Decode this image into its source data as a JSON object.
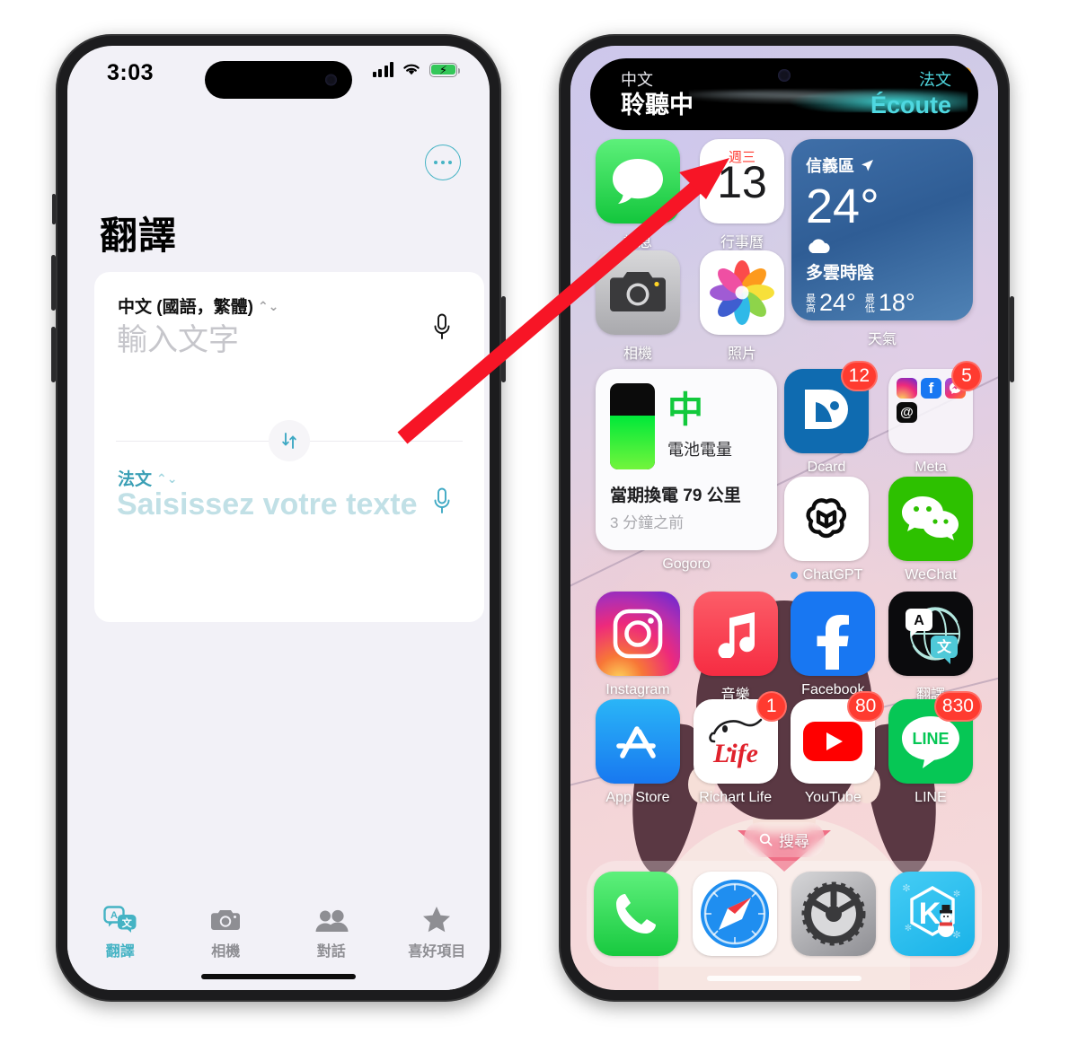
{
  "left_phone": {
    "status_bar": {
      "time": "3:03",
      "signal_icon": "cellular-bars-icon",
      "wifi_icon": "wifi-icon",
      "battery_icon": "battery-charging-icon"
    },
    "more_button": "more-options-icon",
    "app_title": "翻譯",
    "translate_card": {
      "source_language": "中文 (國語，繁體)",
      "source_placeholder": "輸入文字",
      "target_language": "法文",
      "target_placeholder": "Saisissez votre texte",
      "swap_icon": "swap-vertical-icon",
      "mic_icon": "microphone-icon"
    },
    "tabs": [
      {
        "label": "翻譯",
        "icon": "translate-icon",
        "active": true
      },
      {
        "label": "相機",
        "icon": "camera-icon",
        "active": false
      },
      {
        "label": "對話",
        "icon": "people-icon",
        "active": false
      },
      {
        "label": "喜好項目",
        "icon": "star-icon",
        "active": false
      }
    ],
    "accent_color": "#45b3c4"
  },
  "right_phone": {
    "mic_indicator": "orange-microphone-dot",
    "dynamic_island": {
      "left_small": "中文",
      "left_big": "聆聽中",
      "right_small": "法文",
      "right_big": "Écoute",
      "waveform_color": "#40e2e2"
    },
    "row1": [
      {
        "name": "訊息",
        "icon": "messages-icon"
      },
      {
        "name": "行事曆",
        "icon": "calendar-icon",
        "weekday": "週三",
        "day": "13"
      }
    ],
    "weather_widget": {
      "location": "信義區",
      "location_icon": "location-arrow-icon",
      "temperature": "24°",
      "condition_icon": "cloud-icon",
      "condition": "多雲時陰",
      "high_label": "最高",
      "high": "24°",
      "low_label": "最低",
      "low": "18°",
      "label": "天氣"
    },
    "row2": [
      {
        "name": "相機",
        "icon": "camera-app-icon"
      },
      {
        "name": "照片",
        "icon": "photos-icon"
      }
    ],
    "gogoro_widget": {
      "battery_icon": "battery-level-icon",
      "level": "中",
      "level_caption": "電池電量",
      "range_text": "當期換電 79 公里",
      "updated": "3 分鐘之前",
      "label": "Gogoro"
    },
    "row3": [
      {
        "name": "Dcard",
        "icon": "dcard-icon",
        "badge": "12"
      },
      {
        "name": "Meta",
        "icon": "meta-folder-icon",
        "badge": "5"
      }
    ],
    "row4": [
      {
        "name": "ChatGPT",
        "icon": "chatgpt-icon",
        "new_dot": true
      },
      {
        "name": "WeChat",
        "icon": "wechat-icon"
      }
    ],
    "row5": [
      {
        "name": "Instagram",
        "icon": "instagram-icon"
      },
      {
        "name": "音樂",
        "icon": "apple-music-icon"
      },
      {
        "name": "Facebook",
        "icon": "facebook-icon"
      },
      {
        "name": "翻譯",
        "icon": "translate-app-icon"
      }
    ],
    "row6": [
      {
        "name": "App Store",
        "icon": "app-store-icon"
      },
      {
        "name": "Richart Life",
        "icon": "richart-life-icon",
        "badge": "1"
      },
      {
        "name": "YouTube",
        "icon": "youtube-icon",
        "badge": "80"
      },
      {
        "name": "LINE",
        "icon": "line-icon",
        "badge": "830"
      }
    ],
    "search_pill": {
      "label": "搜尋",
      "icon": "search-icon"
    },
    "dock": [
      {
        "name": "Phone",
        "icon": "phone-icon"
      },
      {
        "name": "Safari",
        "icon": "safari-icon"
      },
      {
        "name": "Settings",
        "icon": "settings-gear-icon"
      },
      {
        "name": "KKBOX",
        "icon": "kkbox-icon"
      }
    ]
  },
  "annotation": {
    "arrow_color": "#f71526",
    "arrow_name": "red-pointer-arrow"
  }
}
